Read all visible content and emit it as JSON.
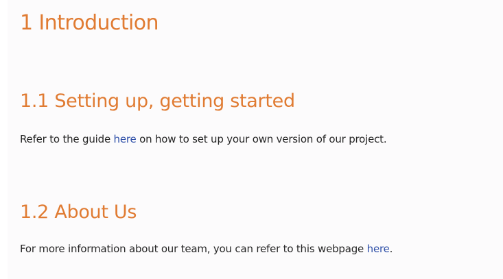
{
  "colors": {
    "heading": "#e07b32",
    "text": "#262626",
    "link": "#2e4fa8",
    "background": "#fcfbfc"
  },
  "title": "1 Introduction",
  "sections": [
    {
      "heading": "1.1 Setting up, getting started",
      "text_before": "Refer to the guide ",
      "link_text": "here",
      "text_after": " on how to set up your own version of our project."
    },
    {
      "heading": "1.2 About Us",
      "text_before": "For more information about our team, you can refer to this webpage ",
      "link_text": "here",
      "text_after": "."
    }
  ]
}
